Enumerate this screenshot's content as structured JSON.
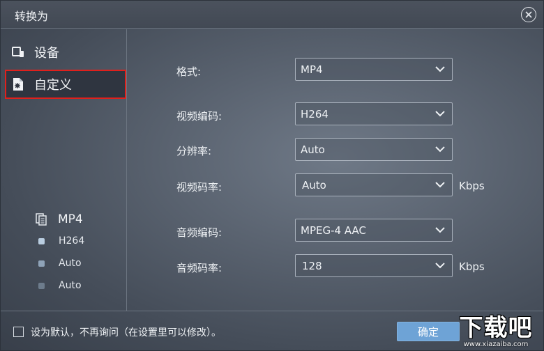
{
  "window": {
    "title": "转换为"
  },
  "sidebar": {
    "items": [
      {
        "label": "设备",
        "icon": "device-icon",
        "active": false
      },
      {
        "label": "自定义",
        "icon": "custom-file-icon",
        "active": true
      }
    ],
    "summary": {
      "format": "MP4",
      "rows": [
        {
          "value": "H264",
          "color": "#b9cde0"
        },
        {
          "value": "Auto",
          "color": "#8fa3b8"
        },
        {
          "value": "Auto",
          "color": "#6d7c8c"
        }
      ]
    }
  },
  "form": {
    "format": {
      "label": "格式:",
      "value": "MP4"
    },
    "video_codec": {
      "label": "视频编码:",
      "value": "H264"
    },
    "resolution": {
      "label": "分辨率:",
      "value": "Auto"
    },
    "video_bitrate": {
      "label": "视频码率:",
      "value": "Auto",
      "unit": "Kbps"
    },
    "audio_codec": {
      "label": "音频编码:",
      "value": "MPEG-4 AAC"
    },
    "audio_bitrate": {
      "label": "音频码率:",
      "value": "128",
      "unit": "Kbps"
    }
  },
  "footer": {
    "checkbox_label": "设为默认，不再询问（在设置里可以修改）。",
    "ok_label": "确定"
  },
  "watermark": {
    "text": "下载吧",
    "url": "www.xiazaiba.com"
  },
  "colors": {
    "accent": "#6ea3d6",
    "highlight_border": "#e0201c"
  }
}
